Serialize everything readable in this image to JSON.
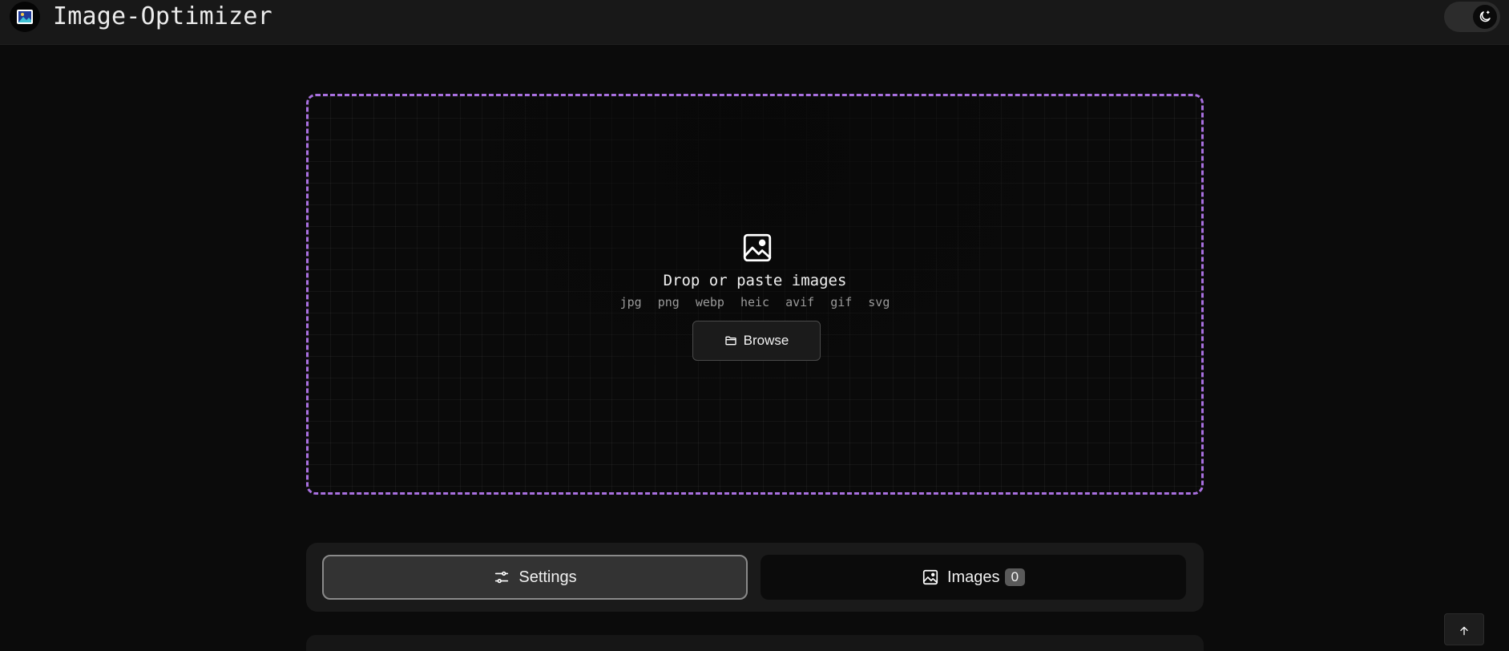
{
  "header": {
    "title": "Image-Optimizer",
    "logo_icon": "image-app-logo-icon",
    "theme_toggle_icon": "moon-icon"
  },
  "dropzone": {
    "icon": "image-icon",
    "title": "Drop or paste images",
    "formats": [
      "jpg",
      "png",
      "webp",
      "heic",
      "avif",
      "gif",
      "svg"
    ],
    "browse_label": "Browse",
    "browse_icon": "folder-icon",
    "border_color": "#a970e0"
  },
  "tabs": {
    "settings": {
      "label": "Settings",
      "icon": "sliders-icon",
      "active": true
    },
    "images": {
      "label": "Images",
      "icon": "image-icon",
      "count": "0",
      "active": false
    }
  },
  "scroll_top_icon": "arrow-up-icon"
}
